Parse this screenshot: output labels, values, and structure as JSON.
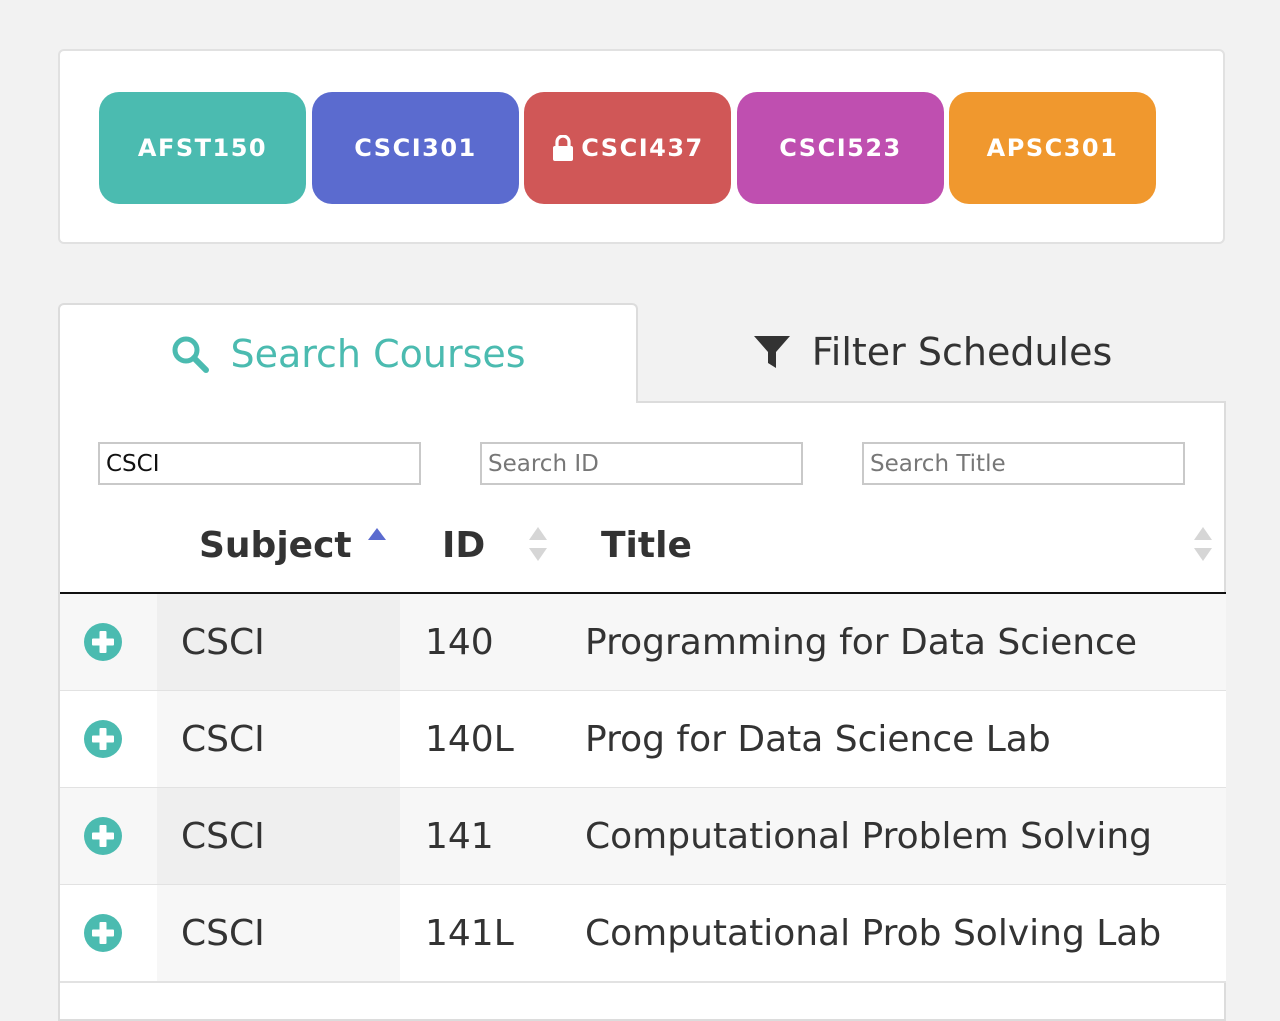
{
  "selected_courses": [
    {
      "label": "AFST150",
      "color": "#4bbbb0",
      "locked": false
    },
    {
      "label": "CSCI301",
      "color": "#5b6bcf",
      "locked": false
    },
    {
      "label": "CSCI437",
      "color": "#d05757",
      "locked": true
    },
    {
      "label": "CSCI523",
      "color": "#bf4fb0",
      "locked": false
    },
    {
      "label": "APSC301",
      "color": "#f0982e",
      "locked": false
    }
  ],
  "tabs": {
    "search_label": "Search Courses",
    "filter_label": "Filter Schedules"
  },
  "search": {
    "subject_value": "CSCI",
    "id_placeholder": "Search ID",
    "title_placeholder": "Search Title"
  },
  "table": {
    "headers": {
      "subject": "Subject",
      "id": "ID",
      "title": "Title"
    },
    "sort": {
      "column": "subject",
      "direction": "ascending"
    },
    "rows": [
      {
        "subject": "CSCI",
        "id": "140",
        "title": "Programming for Data Science"
      },
      {
        "subject": "CSCI",
        "id": "140L",
        "title": "Prog for Data Science Lab"
      },
      {
        "subject": "CSCI",
        "id": "141",
        "title": "Computational Problem Solving"
      },
      {
        "subject": "CSCI",
        "id": "141L",
        "title": "Computational Prob Solving Lab"
      }
    ]
  },
  "colors": {
    "accent": "#4bbbb0",
    "sort_active": "#5b6bcf"
  }
}
